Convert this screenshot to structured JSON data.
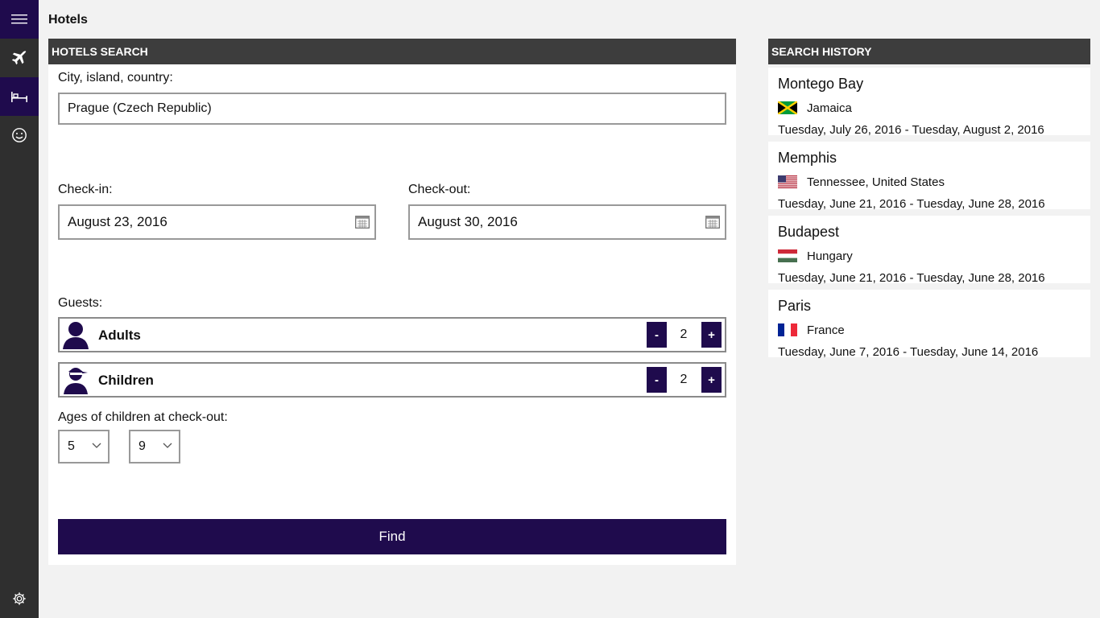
{
  "app": {
    "title": "Hotels"
  },
  "nav": {
    "items": [
      {
        "name": "menu",
        "icon": "hamburger-icon",
        "selected": true
      },
      {
        "name": "flights",
        "icon": "airplane-icon",
        "selected": false
      },
      {
        "name": "hotels",
        "icon": "bed-icon",
        "selected": true
      },
      {
        "name": "feedback",
        "icon": "smiley-icon",
        "selected": false
      },
      {
        "name": "settings",
        "icon": "gear-icon",
        "selected": false
      }
    ]
  },
  "search": {
    "header": "HOTELS SEARCH",
    "destination_label": "City, island, country:",
    "destination_value": "Prague (Czech Republic)",
    "checkin_label": "Check-in:",
    "checkin_value": "August 23, 2016",
    "checkout_label": "Check-out:",
    "checkout_value": "August 30, 2016",
    "guests_label": "Guests:",
    "adults_label": "Adults",
    "adults_value": "2",
    "children_label": "Children",
    "children_value": "2",
    "minus_label": "-",
    "plus_label": "+",
    "ages_label": "Ages of children at check-out:",
    "child_ages": [
      "5",
      "9"
    ],
    "find_label": "Find"
  },
  "history": {
    "header": "SEARCH HISTORY",
    "entries": [
      {
        "city": "Montego Bay",
        "region": "Jamaica",
        "dates": "Tuesday, July 26, 2016 - Tuesday, August 2, 2016",
        "flag": "jamaica-flag-icon"
      },
      {
        "city": "Memphis",
        "region": "Tennessee, United States",
        "dates": "Tuesday, June 21, 2016 - Tuesday, June 28, 2016",
        "flag": "usa-flag-icon"
      },
      {
        "city": "Budapest",
        "region": "Hungary",
        "dates": "Tuesday, June 21, 2016 - Tuesday, June 28, 2016",
        "flag": "hungary-flag-icon"
      },
      {
        "city": "Paris",
        "region": "France",
        "dates": "Tuesday, June 7, 2016 - Tuesday, June 14, 2016",
        "flag": "france-flag-icon"
      }
    ]
  },
  "colors": {
    "accent": "#1f0b4d",
    "rail": "#2f2f2f",
    "header": "#3d3d3d",
    "background": "#f2f2f2"
  }
}
